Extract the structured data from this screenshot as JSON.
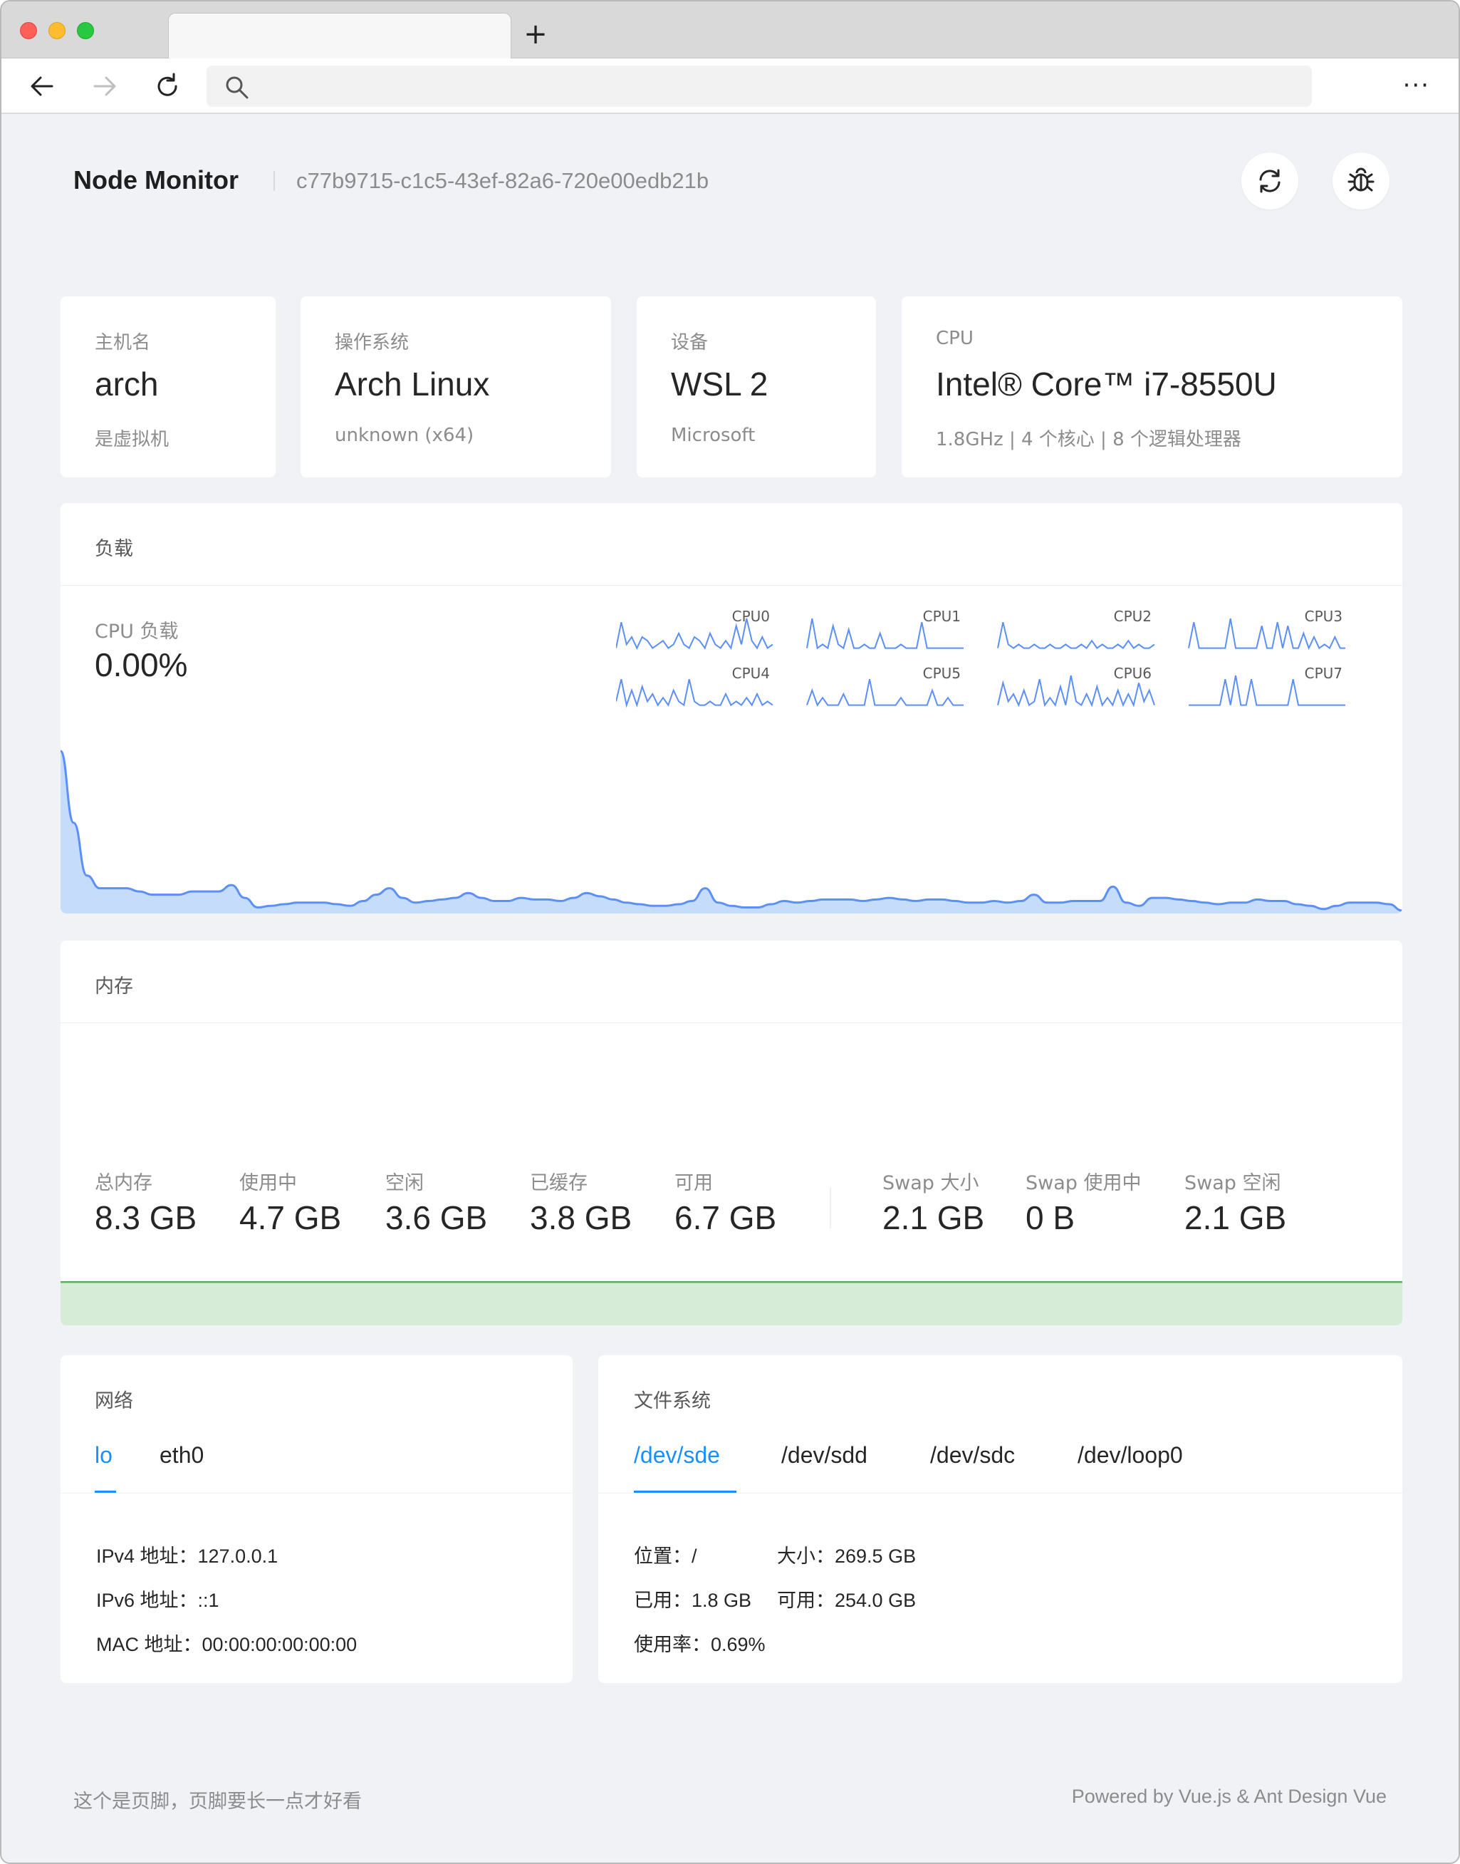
{
  "browser": {
    "tab_title": "",
    "new_tab_symbol": "+",
    "address": "",
    "more_symbol": "···"
  },
  "header": {
    "title": "Node Monitor",
    "node_id": "c77b9715-c1c5-43ef-82a6-720e00edb21b"
  },
  "info": {
    "hostname": {
      "label": "主机名",
      "value": "arch",
      "sub": "是虚拟机"
    },
    "os": {
      "label": "操作系统",
      "value": "Arch Linux",
      "sub": "unknown (x64)"
    },
    "device": {
      "label": "设备",
      "value": "WSL 2",
      "sub": "Microsoft"
    },
    "cpu": {
      "label": "CPU",
      "value": "Intel® Core™ i7-8550U",
      "sub": "1.8GHz | 4 个核心 | 8 个逻辑处理器"
    }
  },
  "load": {
    "title": "负载",
    "cpu_label": "CPU 负载",
    "cpu_value": "0.00%",
    "cores": [
      "CPU0",
      "CPU1",
      "CPU2",
      "CPU3",
      "CPU4",
      "CPU5",
      "CPU6",
      "CPU7"
    ],
    "history": [
      1.0,
      0.55,
      0.22,
      0.14,
      0.14,
      0.14,
      0.12,
      0.1,
      0.1,
      0.1,
      0.12,
      0.12,
      0.12,
      0.16,
      0.08,
      0.02,
      0.03,
      0.04,
      0.05,
      0.05,
      0.05,
      0.04,
      0.03,
      0.06,
      0.1,
      0.14,
      0.08,
      0.05,
      0.06,
      0.07,
      0.08,
      0.11,
      0.08,
      0.06,
      0.06,
      0.08,
      0.07,
      0.07,
      0.06,
      0.08,
      0.11,
      0.09,
      0.07,
      0.05,
      0.04,
      0.03,
      0.03,
      0.04,
      0.06,
      0.14,
      0.05,
      0.03,
      0.02,
      0.02,
      0.04,
      0.06,
      0.05,
      0.06,
      0.07,
      0.07,
      0.07,
      0.06,
      0.07,
      0.08,
      0.07,
      0.06,
      0.07,
      0.07,
      0.06,
      0.05,
      0.05,
      0.06,
      0.05,
      0.06,
      0.1,
      0.05,
      0.05,
      0.06,
      0.06,
      0.06,
      0.15,
      0.05,
      0.03,
      0.08,
      0.08,
      0.07,
      0.06,
      0.05,
      0.04,
      0.05,
      0.05,
      0.07,
      0.06,
      0.06,
      0.04,
      0.03,
      0.01,
      0.03,
      0.05,
      0.05,
      0.05,
      0.04,
      0.0
    ],
    "core_history": [
      [
        0.2,
        0.9,
        0.3,
        0.5,
        0.2,
        0.5,
        0.4,
        0.2,
        0.3,
        0.4,
        0.2,
        0.3,
        0.6,
        0.3,
        0.2,
        0.5,
        0.4,
        0.2,
        0.6,
        0.3,
        0.2,
        0.4,
        0.2,
        0.8,
        0.3,
        1.0,
        0.4,
        0.2,
        0.5,
        0.2,
        0.3
      ],
      [
        0.2,
        1.0,
        0.2,
        0.3,
        0.2,
        0.8,
        0.3,
        0.2,
        0.7,
        0.2,
        0.2,
        0.3,
        0.2,
        0.2,
        0.6,
        0.2,
        0.2,
        0.2,
        0.3,
        0.2,
        0.2,
        0.2,
        0.9,
        0.2,
        0.2,
        0.2,
        0.2,
        0.2,
        0.2,
        0.2,
        0.2
      ],
      [
        0.2,
        0.9,
        0.3,
        0.2,
        0.3,
        0.2,
        0.2,
        0.3,
        0.2,
        0.2,
        0.3,
        0.2,
        0.2,
        0.3,
        0.2,
        0.2,
        0.3,
        0.2,
        0.4,
        0.2,
        0.3,
        0.2,
        0.2,
        0.3,
        0.2,
        0.4,
        0.2,
        0.3,
        0.2,
        0.2,
        0.3
      ],
      [
        0.2,
        0.9,
        0.2,
        0.2,
        0.2,
        0.2,
        0.2,
        0.2,
        1.0,
        0.2,
        0.2,
        0.2,
        0.2,
        0.2,
        0.8,
        0.2,
        0.2,
        0.9,
        0.2,
        0.8,
        0.2,
        0.2,
        0.6,
        0.2,
        0.5,
        0.2,
        0.3,
        0.2,
        0.5,
        0.2,
        0.2
      ],
      [
        0.3,
        0.9,
        0.2,
        0.6,
        0.2,
        0.7,
        0.3,
        0.5,
        0.2,
        0.4,
        0.2,
        0.6,
        0.3,
        0.2,
        0.9,
        0.3,
        0.2,
        0.2,
        0.3,
        0.2,
        0.2,
        0.5,
        0.2,
        0.3,
        0.2,
        0.4,
        0.2,
        0.5,
        0.2,
        0.3,
        0.2
      ],
      [
        0.2,
        0.6,
        0.2,
        0.4,
        0.2,
        0.2,
        0.2,
        0.5,
        0.2,
        0.2,
        0.2,
        0.2,
        0.9,
        0.2,
        0.2,
        0.2,
        0.2,
        0.2,
        0.4,
        0.2,
        0.2,
        0.2,
        0.2,
        0.2,
        0.6,
        0.2,
        0.2,
        0.4,
        0.2,
        0.2,
        0.2
      ],
      [
        0.2,
        0.8,
        0.3,
        0.5,
        0.2,
        0.6,
        0.2,
        0.3,
        0.9,
        0.2,
        0.4,
        0.2,
        0.7,
        0.2,
        1.0,
        0.3,
        0.2,
        0.5,
        0.2,
        0.7,
        0.2,
        0.4,
        0.2,
        0.6,
        0.2,
        0.5,
        0.2,
        0.8,
        0.3,
        0.6,
        0.2
      ],
      [
        0.2,
        0.2,
        0.2,
        0.2,
        0.2,
        0.2,
        0.2,
        0.9,
        0.2,
        1.0,
        0.2,
        0.2,
        0.9,
        0.2,
        0.2,
        0.2,
        0.2,
        0.2,
        0.2,
        0.2,
        0.9,
        0.2,
        0.2,
        0.2,
        0.2,
        0.2,
        0.2,
        0.2,
        0.2,
        0.2,
        0.2
      ]
    ],
    "colors": {
      "line": "#5b8ff9",
      "fill": "#c6dcfb"
    }
  },
  "memory": {
    "title": "内存",
    "stats": [
      {
        "label": "总内存",
        "value": "8.3 GB"
      },
      {
        "label": "使用中",
        "value": "4.7 GB"
      },
      {
        "label": "空闲",
        "value": "3.6 GB"
      },
      {
        "label": "已缓存",
        "value": "3.8 GB"
      },
      {
        "label": "可用",
        "value": "6.7 GB"
      }
    ],
    "swap": [
      {
        "label": "Swap 大小",
        "value": "2.1 GB"
      },
      {
        "label": "Swap 使用中",
        "value": "0 B"
      },
      {
        "label": "Swap 空闲",
        "value": "2.1 GB"
      }
    ],
    "colors": {
      "total_line": "#5ab45a",
      "total_fill": "#d6ecd6",
      "cached_line": "#dfe98a",
      "cached_fill": "#f6f8dc",
      "used_line": "#1890ff",
      "used_fill": "#c4e2fc"
    }
  },
  "network": {
    "title": "网络",
    "tabs": [
      "lo",
      "eth0"
    ],
    "active_tab": "lo",
    "ipv4": "IPv4 地址：127.0.0.1",
    "ipv6": "IPv6 地址：::1",
    "mac": "MAC 地址：00:00:00:00:00:00"
  },
  "filesystem": {
    "title": "文件系统",
    "tabs": [
      "/dev/sde",
      "/dev/sdd",
      "/dev/sdc",
      "/dev/loop0"
    ],
    "active_tab": "/dev/sde",
    "location": "位置：/",
    "size": "大小：269.5 GB",
    "used": "已用：1.8 GB",
    "available": "可用：254.0 GB",
    "usage": "使用率：0.69%"
  },
  "footer": {
    "left": "这个是页脚，页脚要长一点才好看",
    "right": "Powered by Vue.js & Ant Design Vue"
  }
}
